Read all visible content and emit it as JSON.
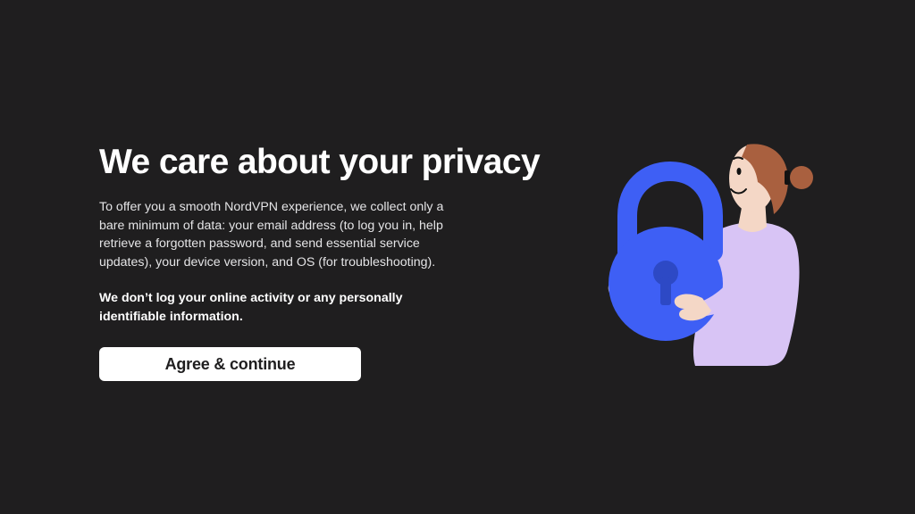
{
  "privacy": {
    "title": "We care about your privacy",
    "description": "To offer you a smooth NordVPN experience, we collect only a bare minimum of data: your email address (to log you in, help retrieve a forgotten password, and send essential service updates), your device version, and OS (for troubleshooting).",
    "emphasis": "We don’t log your online activity or any personally identifiable information.",
    "agree_button_label": "Agree & continue"
  },
  "illustration": {
    "icon": "person-holding-padlock-illustration",
    "colors": {
      "background": "#1f1e1f",
      "lock": "#3e5ff5",
      "shirt": "#d8c4f5",
      "skin": "#f4d7c6",
      "hair": "#a9603f"
    }
  }
}
